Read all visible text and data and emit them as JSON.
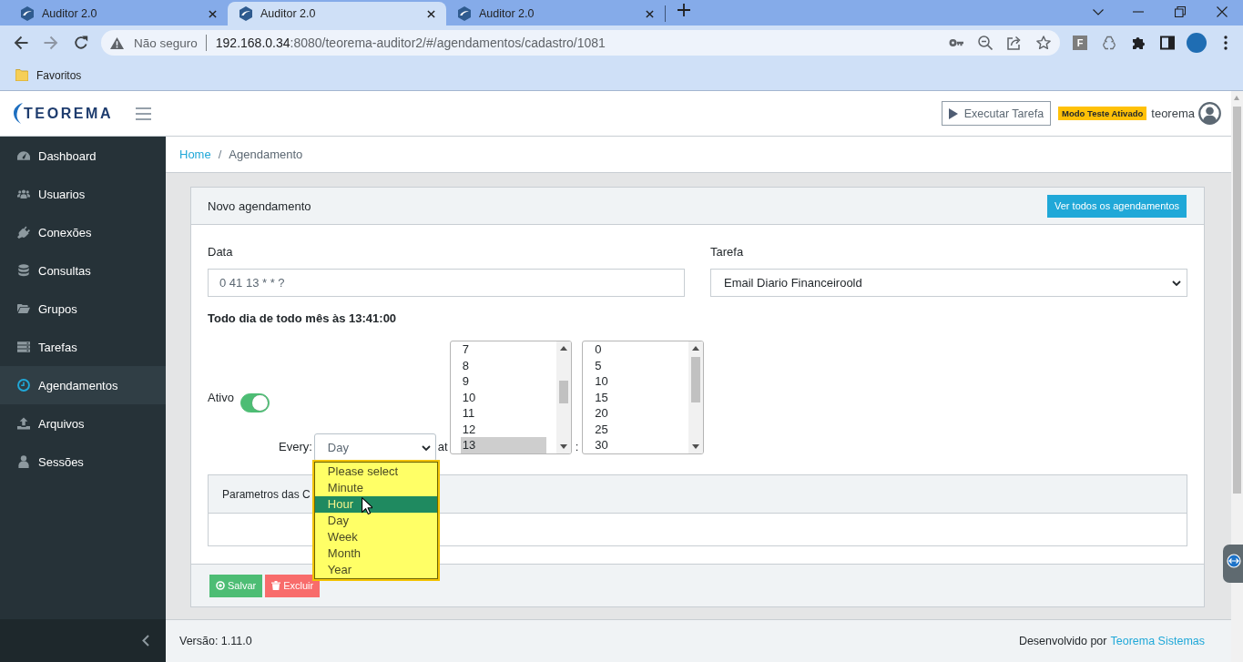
{
  "browser": {
    "tabs": [
      {
        "title": "Auditor 2.0",
        "selected": false
      },
      {
        "title": "Auditor 2.0",
        "selected": true
      },
      {
        "title": "Auditor 2.0",
        "selected": false
      }
    ],
    "address": {
      "security": "Não seguro",
      "host": "192.168.0.34",
      "path": ":8080/teorema-auditor2/#/agendamentos/cadastro/1081"
    },
    "extension_label": "F",
    "bookmarks": [
      {
        "label": "Favoritos"
      }
    ]
  },
  "app": {
    "logo": "TEOREMA",
    "run_button": "Executar Tarefa",
    "mode_badge": "Modo Teste Ativado",
    "user": "teorema"
  },
  "sidebar": {
    "items": [
      {
        "label": "Dashboard",
        "kind": "dashboard",
        "selected": false
      },
      {
        "label": "Usuarios",
        "kind": "users",
        "selected": false
      },
      {
        "label": "Conexões",
        "kind": "plug",
        "selected": false
      },
      {
        "label": "Consultas",
        "kind": "database",
        "selected": false
      },
      {
        "label": "Grupos",
        "kind": "folder",
        "selected": false
      },
      {
        "label": "Tarefas",
        "kind": "tasks",
        "selected": false
      },
      {
        "label": "Agendamentos",
        "kind": "clock",
        "selected": true
      },
      {
        "label": "Arquivos",
        "kind": "upload",
        "selected": false
      },
      {
        "label": "Sessões",
        "kind": "user",
        "selected": false
      }
    ]
  },
  "breadcrumb": {
    "items": [
      {
        "label": "Home",
        "kind": "link"
      },
      {
        "label": "Agendamento",
        "kind": "current"
      }
    ],
    "separator": "/"
  },
  "card": {
    "title": "Novo agendamento",
    "action_button": "Ver todos os agendamentos",
    "fields": [
      {
        "label": "Data",
        "kind": "input",
        "value": "0 41 13 * * ?"
      },
      {
        "label": "Tarefa",
        "kind": "select",
        "value": "Email Diario Financeiroold"
      }
    ],
    "summary": "Todo dia de todo mês às 13:41:00",
    "active": {
      "label": "Ativo",
      "on": true
    },
    "schedule": {
      "every_label": "Every:",
      "every_value": "Day",
      "expanded": true,
      "options": [
        {
          "label": "Please select",
          "selected": false
        },
        {
          "label": "Minute",
          "selected": false
        },
        {
          "label": "Hour",
          "selected": true
        },
        {
          "label": "Day",
          "selected": false
        },
        {
          "label": "Week",
          "selected": false
        },
        {
          "label": "Month",
          "selected": false
        },
        {
          "label": "Year",
          "selected": false
        }
      ],
      "at_label": "at",
      "time_separator": ":",
      "hours": [
        {
          "label": "7",
          "selected": false
        },
        {
          "label": "8",
          "selected": false
        },
        {
          "label": "9",
          "selected": false
        },
        {
          "label": "10",
          "selected": false
        },
        {
          "label": "11",
          "selected": false
        },
        {
          "label": "12",
          "selected": false
        },
        {
          "label": "13",
          "selected": true
        }
      ],
      "minutes": [
        {
          "label": "0",
          "selected": false
        },
        {
          "label": "5",
          "selected": false
        },
        {
          "label": "10",
          "selected": false
        },
        {
          "label": "15",
          "selected": false
        },
        {
          "label": "20",
          "selected": false
        },
        {
          "label": "25",
          "selected": false
        },
        {
          "label": "30",
          "selected": false
        }
      ]
    },
    "parameters_panel": {
      "title": "Parametros das C"
    },
    "buttons": [
      {
        "label": "Salvar",
        "kind": "save"
      },
      {
        "label": "Excluir",
        "kind": "delete"
      }
    ]
  },
  "footer": {
    "version": "Versão: 1.11.0",
    "credit": "Desenvolvido por",
    "credit_link": "Teorema Sistemas"
  }
}
